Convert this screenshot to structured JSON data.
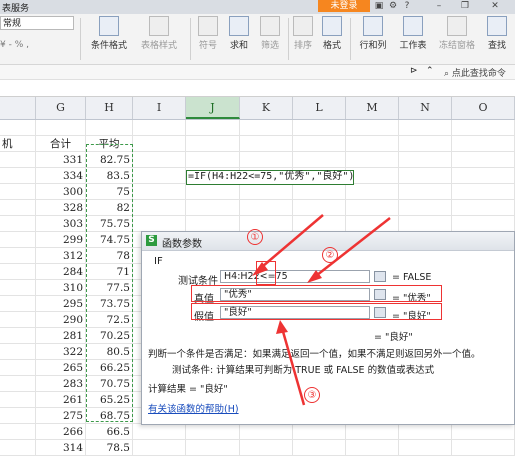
{
  "titlebar": {
    "title": "表服务",
    "login_label": "未登录",
    "icons": [
      "skin-icon",
      "settings-icon",
      "help-icon",
      "minimize-icon",
      "restore-icon",
      "close-icon"
    ]
  },
  "ribbon": {
    "number_format": "常规",
    "percent_row": "¥ - % ,",
    "buttons": [
      {
        "label": "条件格式",
        "name": "conditional-format-button",
        "dim": false
      },
      {
        "label": "表格样式",
        "name": "table-style-button",
        "dim": true
      },
      {
        "label": "符号",
        "name": "symbol-button",
        "dim": true
      },
      {
        "label": "求和",
        "name": "sum-button",
        "dim": false
      },
      {
        "label": "筛选",
        "name": "filter-button",
        "dim": true
      },
      {
        "label": "排序",
        "name": "sort-button",
        "dim": true
      },
      {
        "label": "格式",
        "name": "format-button",
        "dim": false
      },
      {
        "label": "行和列",
        "name": "rows-columns-button",
        "dim": false
      },
      {
        "label": "工作表",
        "name": "worksheet-button",
        "dim": false
      },
      {
        "label": "冻结窗格",
        "name": "freeze-panes-button",
        "dim": true
      },
      {
        "label": "查找",
        "name": "find-button",
        "dim": false
      }
    ],
    "search_placeholder": "点此查找命令"
  },
  "columns": [
    "G",
    "H",
    "I",
    "J",
    "K",
    "L",
    "M",
    "N",
    "O"
  ],
  "selected_column": "J",
  "header_row": {
    "f": "机",
    "g": "合计",
    "h": "平均"
  },
  "rows": [
    {
      "g": "331",
      "h": "82.75"
    },
    {
      "g": "334",
      "h": "83.5"
    },
    {
      "g": "300",
      "h": "75"
    },
    {
      "g": "328",
      "h": "82"
    },
    {
      "g": "303",
      "h": "75.75"
    },
    {
      "g": "299",
      "h": "74.75"
    },
    {
      "g": "312",
      "h": "78"
    },
    {
      "g": "284",
      "h": "71"
    },
    {
      "g": "310",
      "h": "77.5"
    },
    {
      "g": "295",
      "h": "73.75"
    },
    {
      "g": "290",
      "h": "72.5"
    },
    {
      "g": "281",
      "h": "70.25"
    },
    {
      "g": "322",
      "h": "80.5"
    },
    {
      "g": "265",
      "h": "66.25"
    },
    {
      "g": "283",
      "h": "70.75"
    },
    {
      "g": "261",
      "h": "65.25"
    },
    {
      "g": "275",
      "h": "68.75"
    },
    {
      "g": "266",
      "h": "66.5"
    },
    {
      "g": "314",
      "h": "78.5"
    }
  ],
  "formula_cell_text": "=IF(H4:H22<=75,\"优秀\",\"良好\")",
  "dialog": {
    "title": "函数参数",
    "function_name": "IF",
    "params": [
      {
        "label": "测试条件",
        "value": "H4:H22<=75",
        "result": "= FALSE"
      },
      {
        "label": "真值",
        "value": "\"优秀\"",
        "result": "= \"优秀\""
      },
      {
        "label": "假值",
        "value": "\"良好\"",
        "result": "= \"良好\""
      }
    ],
    "overall_result": "= \"良好\"",
    "description": "判断一个条件是否满足：如果满足返回一个值，如果不满足则返回另外一个值。",
    "param_description": "测试条件:  计算结果可判断为 TRUE 或 FALSE 的数值或表达式",
    "calc_result": "计算结果 = \"良好\"",
    "help_link": "有关该函数的帮助(H)"
  },
  "annotations": [
    "①",
    "②",
    "③"
  ],
  "annotation_color": "#ee3333",
  "selection_color": "#2e7d32"
}
